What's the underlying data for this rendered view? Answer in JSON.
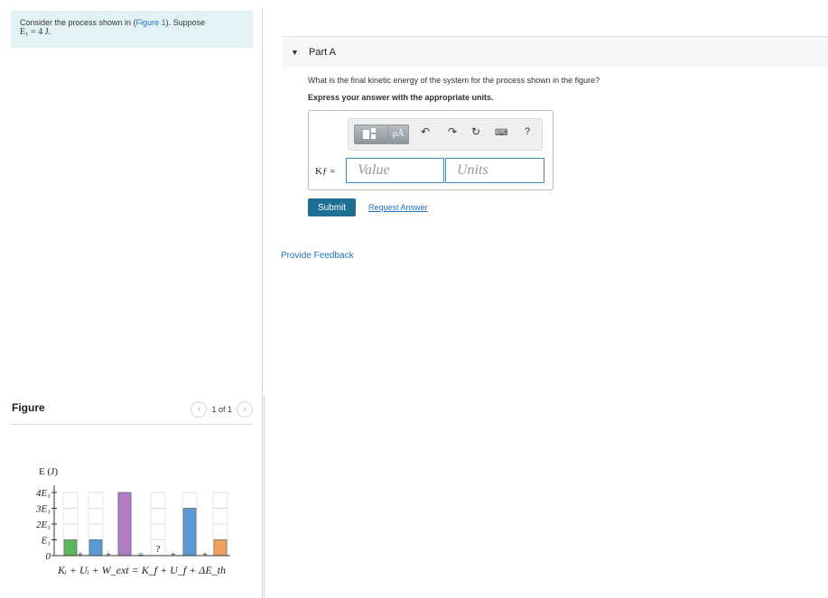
{
  "problem": {
    "text_prefix": "Consider the process shown in (",
    "figure_link": "Figure 1",
    "text_suffix": "). Suppose",
    "math_line": "E₁ = 4 J."
  },
  "figure": {
    "title": "Figure",
    "pager_text": "1 of 1",
    "prev_icon": "chevron-left-icon",
    "next_icon": "chevron-right-icon"
  },
  "chart_data": {
    "type": "bar",
    "ylabel": "E (J)",
    "y_ticks": [
      "4E₁",
      "3E₁",
      "2E₁",
      "E₁",
      "0"
    ],
    "categories": [
      "Kᵢ",
      "Uᵢ",
      "W_ext",
      "K_f",
      "U_f",
      "ΔE_th"
    ],
    "values": [
      1,
      1,
      4,
      null,
      3,
      1
    ],
    "unit": "E₁",
    "unknown_label": "?",
    "bar_colors": [
      "#5cb85c",
      "#5b9bd5",
      "#b07cc6",
      null,
      "#5b9bd5",
      "#f0a05a"
    ],
    "equation": "Kᵢ + Uᵢ + W_ext = K_f + U_f + ΔE_th"
  },
  "part": {
    "title": "Part A",
    "question": "What is the final kinetic energy of the system for the process shown in the figure?",
    "instruction": "Express your answer with the appropriate units."
  },
  "answer": {
    "variable_label": "Kƒ =",
    "value_placeholder": "Value",
    "units_placeholder": "Units",
    "toolbar_icons": [
      "templates-icon",
      "units-icon",
      "undo-icon",
      "redo-icon",
      "reset-icon",
      "keyboard-icon",
      "help-icon"
    ],
    "units_button_text": "µÅ",
    "help_text": "?"
  },
  "actions": {
    "submit_label": "Submit",
    "request_label": "Request Answer",
    "feedback_label": "Provide Feedback"
  }
}
